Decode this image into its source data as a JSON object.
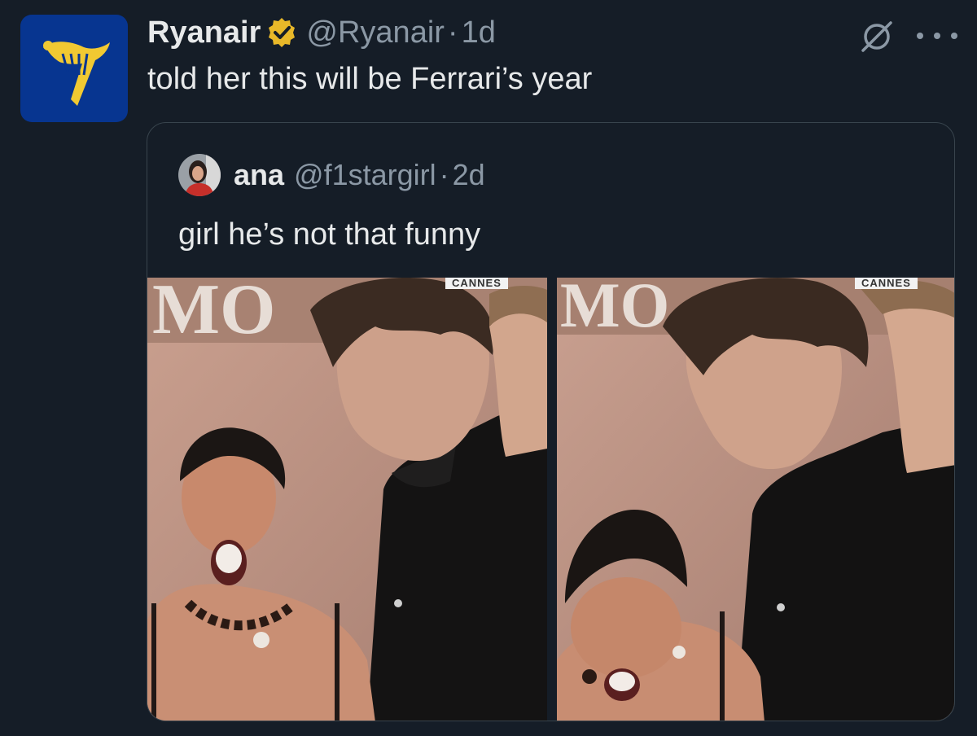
{
  "tweet": {
    "display_name": "Ryanair",
    "handle": "@Ryanair",
    "separator": "·",
    "time": "1d",
    "text": "told her this will be Ferrari’s year",
    "icons": [
      "ryanair-harp-logo",
      "verified-badge-gold",
      "grok-icon",
      "more-icon"
    ],
    "colors": {
      "avatar_bg": "#073590",
      "logo_yellow": "#f1c932",
      "badge_gold": "#e8b829"
    }
  },
  "quote": {
    "display_name": "ana",
    "handle": "@f1stargirl",
    "separator": "·",
    "time": "2d",
    "text": "girl he’s not that funny",
    "media": [
      {
        "watermark": "CANNES",
        "backdrop_text": "MO"
      },
      {
        "watermark": "CANNES",
        "backdrop_text": "MO"
      }
    ]
  },
  "theme": {
    "background": "#151d27",
    "text": "#e7e9ea",
    "muted": "#8b98a5",
    "border": "#38444d"
  }
}
